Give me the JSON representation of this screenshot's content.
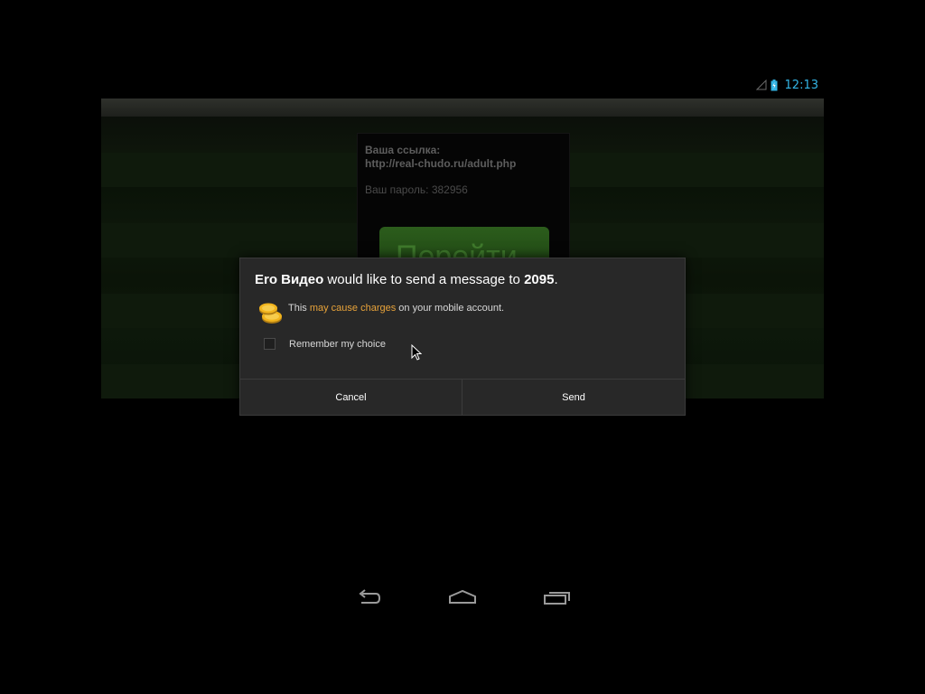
{
  "status_bar": {
    "time": "12:13",
    "accent_color": "#33b5e5",
    "icons": [
      "signal-icon",
      "battery-icon"
    ]
  },
  "background_app": {
    "link_label": "Ваша ссылка:",
    "link_url": "http://real-chudo.ru/adult.php",
    "password_text": "Ваш пароль: 382956",
    "go_button_label": "Перейти"
  },
  "dialog": {
    "app_name": "Ero Видео",
    "title_middle": " would like to send a message to ",
    "number": "2095",
    "title_end": ".",
    "warning_prefix": "This ",
    "warning_highlight": "may cause charges",
    "warning_suffix": " on your mobile account.",
    "warning_highlight_color": "#e8a33a",
    "icon": "coins-icon",
    "remember_label": "Remember my choice",
    "remember_checked": false,
    "cancel_label": "Cancel",
    "send_label": "Send"
  },
  "nav_bar": {
    "icons": [
      "back-icon",
      "home-icon",
      "recents-icon"
    ]
  }
}
